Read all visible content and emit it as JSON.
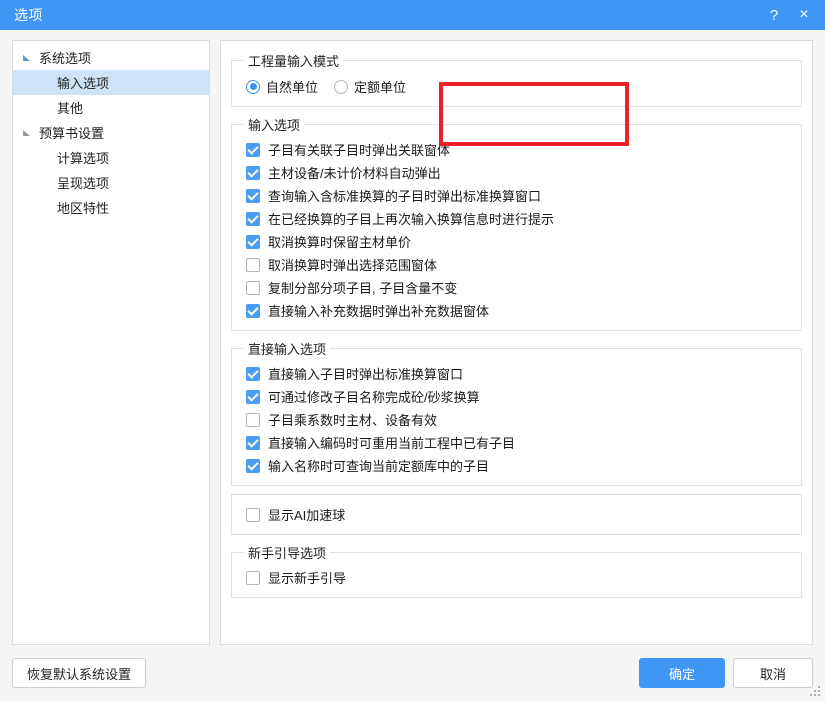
{
  "window": {
    "title": "选项",
    "help_icon": "?",
    "close_icon": "×",
    "accent_color": "#4096f5",
    "annotation_color": "#ea2127",
    "selection_color": "#cde4f8"
  },
  "sidebar": {
    "items": [
      {
        "label": "系统选项",
        "level": 0,
        "expanded": true,
        "selected": false,
        "arrow": "expanded-arrow-blue"
      },
      {
        "label": "输入选项",
        "level": 1,
        "expanded": false,
        "selected": true,
        "arrow": "none"
      },
      {
        "label": "其他",
        "level": 1,
        "expanded": false,
        "selected": false,
        "arrow": "none"
      },
      {
        "label": "预算书设置",
        "level": 0,
        "expanded": true,
        "selected": false,
        "arrow": "expanded-arrow-gray"
      },
      {
        "label": "计算选项",
        "level": 1,
        "expanded": false,
        "selected": false,
        "arrow": "none"
      },
      {
        "label": "呈现选项",
        "level": 1,
        "expanded": false,
        "selected": false,
        "arrow": "none"
      },
      {
        "label": "地区特性",
        "level": 1,
        "expanded": false,
        "selected": false,
        "arrow": "none"
      }
    ]
  },
  "content": {
    "groups": [
      {
        "id": "quantity-input-mode",
        "legend": "工程量输入模式",
        "type": "radio",
        "highlighted": true,
        "radios": [
          {
            "label": "自然单位",
            "checked": true
          },
          {
            "label": "定额单位",
            "checked": false
          }
        ]
      },
      {
        "id": "input-options",
        "legend": "输入选项",
        "type": "checkbox",
        "highlighted": false,
        "checkboxes": [
          {
            "label": "子目有关联子目时弹出关联窗体",
            "checked": true
          },
          {
            "label": "主材设备/未计价材料自动弹出",
            "checked": true
          },
          {
            "label": "查询输入含标准换算的子目时弹出标准换算窗口",
            "checked": true
          },
          {
            "label": "在已经换算的子目上再次输入换算信息时进行提示",
            "checked": true
          },
          {
            "label": "取消换算时保留主材单价",
            "checked": true
          },
          {
            "label": "取消换算时弹出选择范围窗体",
            "checked": false
          },
          {
            "label": "复制分部分项子目, 子目含量不变",
            "checked": false
          },
          {
            "label": "直接输入补充数据时弹出补充数据窗体",
            "checked": true
          }
        ]
      },
      {
        "id": "direct-input-options",
        "legend": "直接输入选项",
        "type": "checkbox",
        "highlighted": false,
        "checkboxes": [
          {
            "label": "直接输入子目时弹出标准换算窗口",
            "checked": true
          },
          {
            "label": "可通过修改子目名称完成砼/砂浆换算",
            "checked": true
          },
          {
            "label": "子目乘系数时主材、设备有效",
            "checked": false
          },
          {
            "label": "直接输入编码时可重用当前工程中已有子目",
            "checked": true
          },
          {
            "label": "输入名称时可查询当前定额库中的子目",
            "checked": true
          }
        ]
      },
      {
        "id": "ai-ball-options",
        "legend": "",
        "type": "checkbox",
        "highlighted": false,
        "checkboxes": [
          {
            "label": "显示AI加速球",
            "checked": false
          }
        ]
      },
      {
        "id": "beginner-guide-options",
        "legend": "新手引导选项",
        "type": "checkbox",
        "highlighted": false,
        "checkboxes": [
          {
            "label": "显示新手引导",
            "checked": false
          }
        ]
      }
    ]
  },
  "footer": {
    "restore_defaults_label": "恢复默认系统设置",
    "ok_label": "确定",
    "cancel_label": "取消"
  }
}
